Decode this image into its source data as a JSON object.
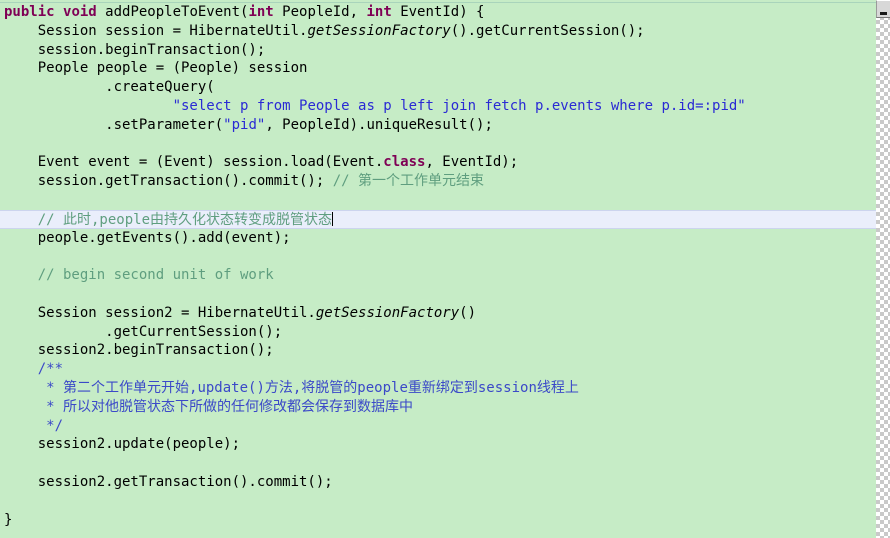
{
  "editor": {
    "background_color": "#c6ecc6",
    "current_line_color": "#eaeefb",
    "font_family_kind": "monospace",
    "colors": {
      "keyword": "#7f0055",
      "string": "#2a2ad4",
      "comment": "#5f9e7f",
      "javadoc": "#3b49c8",
      "plain": "#000000"
    },
    "current_line_index": 11,
    "caret_present": true
  },
  "scrollbar": {
    "name": "vertical-scrollbar",
    "arrow_icon": "chevron-up-icon",
    "visible": true
  },
  "code": {
    "language": "java",
    "lines": [
      {
        "n": 1,
        "tokens": [
          {
            "t": "public",
            "k": "kw"
          },
          {
            "t": " ",
            "k": "plain"
          },
          {
            "t": "void",
            "k": "kw"
          },
          {
            "t": " addPeopleToEvent(",
            "k": "plain"
          },
          {
            "t": "int",
            "k": "kw"
          },
          {
            "t": " PeopleId, ",
            "k": "plain"
          },
          {
            "t": "int",
            "k": "kw"
          },
          {
            "t": " EventId) {",
            "k": "plain"
          }
        ]
      },
      {
        "n": 2,
        "tokens": [
          {
            "t": "    Session session = HibernateUtil.",
            "k": "plain"
          },
          {
            "t": "getSessionFactory",
            "k": "ital"
          },
          {
            "t": "().getCurrentSession();",
            "k": "plain"
          }
        ]
      },
      {
        "n": 3,
        "tokens": [
          {
            "t": "    session.beginTransaction();",
            "k": "plain"
          }
        ]
      },
      {
        "n": 4,
        "tokens": [
          {
            "t": "    People people = (People) session",
            "k": "plain"
          }
        ]
      },
      {
        "n": 5,
        "tokens": [
          {
            "t": "            .createQuery(",
            "k": "plain"
          }
        ]
      },
      {
        "n": 6,
        "tokens": [
          {
            "t": "                    ",
            "k": "plain"
          },
          {
            "t": "\"select p from People as p left join fetch p.events where p.id=:pid\"",
            "k": "str"
          }
        ]
      },
      {
        "n": 7,
        "tokens": [
          {
            "t": "            .setParameter(",
            "k": "plain"
          },
          {
            "t": "\"pid\"",
            "k": "str"
          },
          {
            "t": ", PeopleId).uniqueResult();",
            "k": "plain"
          }
        ]
      },
      {
        "n": 8,
        "tokens": []
      },
      {
        "n": 9,
        "tokens": [
          {
            "t": "    Event event = (Event) session.load(Event.",
            "k": "plain"
          },
          {
            "t": "class",
            "k": "kw"
          },
          {
            "t": ", EventId);",
            "k": "plain"
          }
        ]
      },
      {
        "n": 10,
        "tokens": [
          {
            "t": "    session.getTransaction().commit(); ",
            "k": "plain"
          },
          {
            "t": "// 第一个工作单元结束",
            "k": "cmt"
          }
        ]
      },
      {
        "n": 11,
        "tokens": []
      },
      {
        "n": 12,
        "tokens": [
          {
            "t": "    ",
            "k": "plain"
          },
          {
            "t": "// 此时,people由持久化状态转变成脱管状态",
            "k": "cmt"
          }
        ],
        "current": true,
        "caret": true
      },
      {
        "n": 13,
        "tokens": [
          {
            "t": "    people.getEvents().add(event);",
            "k": "plain"
          }
        ]
      },
      {
        "n": 14,
        "tokens": []
      },
      {
        "n": 15,
        "tokens": [
          {
            "t": "    ",
            "k": "plain"
          },
          {
            "t": "// begin second unit of work",
            "k": "cmt"
          }
        ]
      },
      {
        "n": 16,
        "tokens": []
      },
      {
        "n": 17,
        "tokens": [
          {
            "t": "    Session session2 = HibernateUtil.",
            "k": "plain"
          },
          {
            "t": "getSessionFactory",
            "k": "ital"
          },
          {
            "t": "()",
            "k": "plain"
          }
        ]
      },
      {
        "n": 18,
        "tokens": [
          {
            "t": "            .getCurrentSession();",
            "k": "plain"
          }
        ]
      },
      {
        "n": 19,
        "tokens": [
          {
            "t": "    session2.beginTransaction();",
            "k": "plain"
          }
        ]
      },
      {
        "n": 20,
        "tokens": [
          {
            "t": "    ",
            "k": "plain"
          },
          {
            "t": "/**",
            "k": "doc"
          }
        ]
      },
      {
        "n": 21,
        "tokens": [
          {
            "t": "     ",
            "k": "plain"
          },
          {
            "t": "* 第二个工作单元开始,update()方法,将脱管的people重新绑定到session线程上",
            "k": "doc"
          }
        ]
      },
      {
        "n": 22,
        "tokens": [
          {
            "t": "     ",
            "k": "plain"
          },
          {
            "t": "* 所以对他脱管状态下所做的任何修改都会保存到数据库中",
            "k": "doc"
          }
        ]
      },
      {
        "n": 23,
        "tokens": [
          {
            "t": "     ",
            "k": "plain"
          },
          {
            "t": "*/",
            "k": "doc"
          }
        ]
      },
      {
        "n": 24,
        "tokens": [
          {
            "t": "    session2.update(people);",
            "k": "plain"
          }
        ]
      },
      {
        "n": 25,
        "tokens": []
      },
      {
        "n": 26,
        "tokens": [
          {
            "t": "    session2.getTransaction().commit();",
            "k": "plain"
          }
        ]
      },
      {
        "n": 27,
        "tokens": []
      },
      {
        "n": 28,
        "tokens": [
          {
            "t": "}",
            "k": "plain"
          }
        ]
      }
    ]
  }
}
